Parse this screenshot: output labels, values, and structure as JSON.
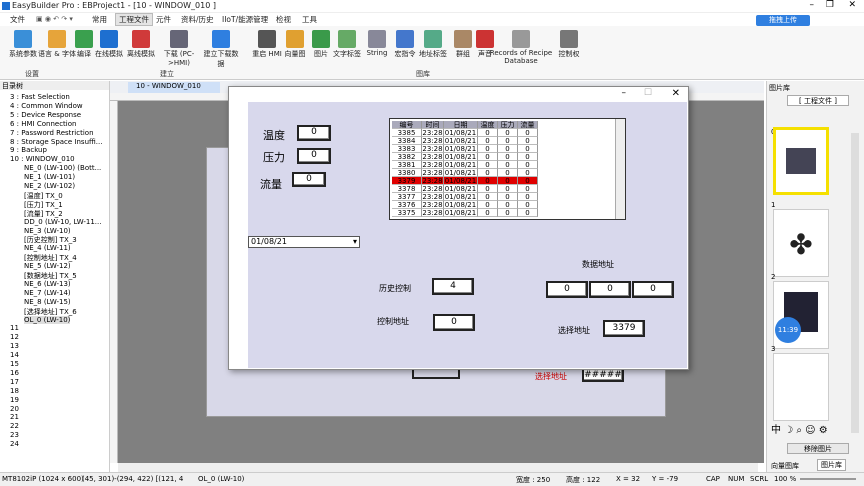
{
  "title": "EasyBuilder Pro : EBProject1 - [10 - WINDOW_010 ]",
  "menu": [
    "文件",
    "常用",
    "工程文件",
    "元件",
    "资料/历史",
    "IIoT/能源管理",
    "检视",
    "工具"
  ],
  "ribbon": [
    {
      "label": "系统参数"
    },
    {
      "label": "语言 & 字体"
    },
    {
      "label": "编译"
    },
    {
      "label": "在线模拟"
    },
    {
      "label": "离线模拟"
    },
    {
      "label": "下载 (PC->HMI)"
    },
    {
      "label": "建立下载数据"
    },
    {
      "label": "重启 HMI"
    },
    {
      "label": "向量图"
    },
    {
      "label": "图片"
    },
    {
      "label": "文字标签"
    },
    {
      "label": "String"
    },
    {
      "label": "宏指令"
    },
    {
      "label": "地址标签"
    },
    {
      "label": "群组"
    },
    {
      "label": "声音"
    },
    {
      "label": "Records of Recipe Database"
    },
    {
      "label": "控制权"
    }
  ],
  "groups": [
    "设置",
    "建立",
    "图库"
  ],
  "tree_title": "目录树",
  "tree": [
    "3 : Fast Selection",
    "4 : Common Window",
    "5 : Device Response",
    "6 : HMI Connection",
    "7 : Password Restriction",
    "8 : Storage Space Insuffi...",
    "9 : Backup",
    "10 : WINDOW_010",
    "NE_0 (LW-100) (Bott...",
    "NE_1 (LW-101)",
    "NE_2 (LW-102)",
    "[温度] TX_0",
    "[压力] TX_1",
    "[流量] TX_2",
    "DD_0 (LW-10, LW-11...",
    "NE_3 (LW-10)",
    "[历史控制] TX_3",
    "NE_4 (LW-11)",
    "[控制地址] TX_4",
    "NE_5 (LW-12)",
    "[数据地址] TX_5",
    "NE_6 (LW-13)",
    "NE_7 (LW-14)",
    "NE_8 (LW-15)",
    "[选择地址] TX_6",
    "OL_0 (LW-10)",
    "11",
    "12",
    "13",
    "14",
    "15",
    "16",
    "17",
    "18",
    "19",
    "20",
    "21",
    "22",
    "23",
    "24"
  ],
  "tab": "10 - WINDOW_010",
  "dlg": {
    "temp": "温度",
    "press": "压力",
    "flow": "流量",
    "v0": "0",
    "v1": "0",
    "v2": "0",
    "date": "01/08/21",
    "hist": "历史控制",
    "histv": "4",
    "ctrl": "控制地址",
    "ctrlv": "0",
    "data": "数据地址",
    "d0": "0",
    "d1": "0",
    "d2": "0",
    "sel": "选择地址",
    "selv": "3379",
    "bgsel": "选择地址",
    "bgv": "#####"
  },
  "table": {
    "headers": [
      "编号",
      "时间",
      "日期",
      "温度",
      "压力",
      "流量"
    ],
    "rows": [
      [
        "3385",
        "23:28",
        "01/08/21",
        "0",
        "0",
        "0"
      ],
      [
        "3384",
        "23:28",
        "01/08/21",
        "0",
        "0",
        "0"
      ],
      [
        "3383",
        "23:28",
        "01/08/21",
        "0",
        "0",
        "0"
      ],
      [
        "3382",
        "23:28",
        "01/08/21",
        "0",
        "0",
        "0"
      ],
      [
        "3381",
        "23:28",
        "01/08/21",
        "0",
        "0",
        "0"
      ],
      [
        "3380",
        "23:28",
        "01/08/21",
        "0",
        "0",
        "0"
      ],
      [
        "3379",
        "23:28",
        "01/08/21",
        "0",
        "0",
        "0"
      ],
      [
        "3378",
        "23:28",
        "01/08/21",
        "0",
        "0",
        "0"
      ],
      [
        "3377",
        "23:28",
        "01/08/21",
        "0",
        "0",
        "0"
      ],
      [
        "3376",
        "23:28",
        "01/08/21",
        "0",
        "0",
        "0"
      ],
      [
        "3375",
        "23:28",
        "01/08/21",
        "0",
        "0",
        "0"
      ]
    ],
    "selected": 6
  },
  "right": {
    "title": "图片库",
    "dropdown": "[ 工程文件 ]",
    "nums": [
      "0",
      "1",
      "2",
      "3"
    ],
    "clock": "11:39",
    "move": "移除图片",
    "tabs": [
      "向量图库",
      "图片库"
    ],
    "upload": "拖拽上传"
  },
  "status": [
    "MT8102iP (1024 x 600)",
    "(45, 301)-(294, 422) [(121, 4",
    "OL_0 (LW-10)",
    "宽度 : 250",
    "高度 : 122",
    "X = 32",
    "Y = -79",
    "CAP",
    "NUM",
    "SCRL",
    "100 %"
  ]
}
